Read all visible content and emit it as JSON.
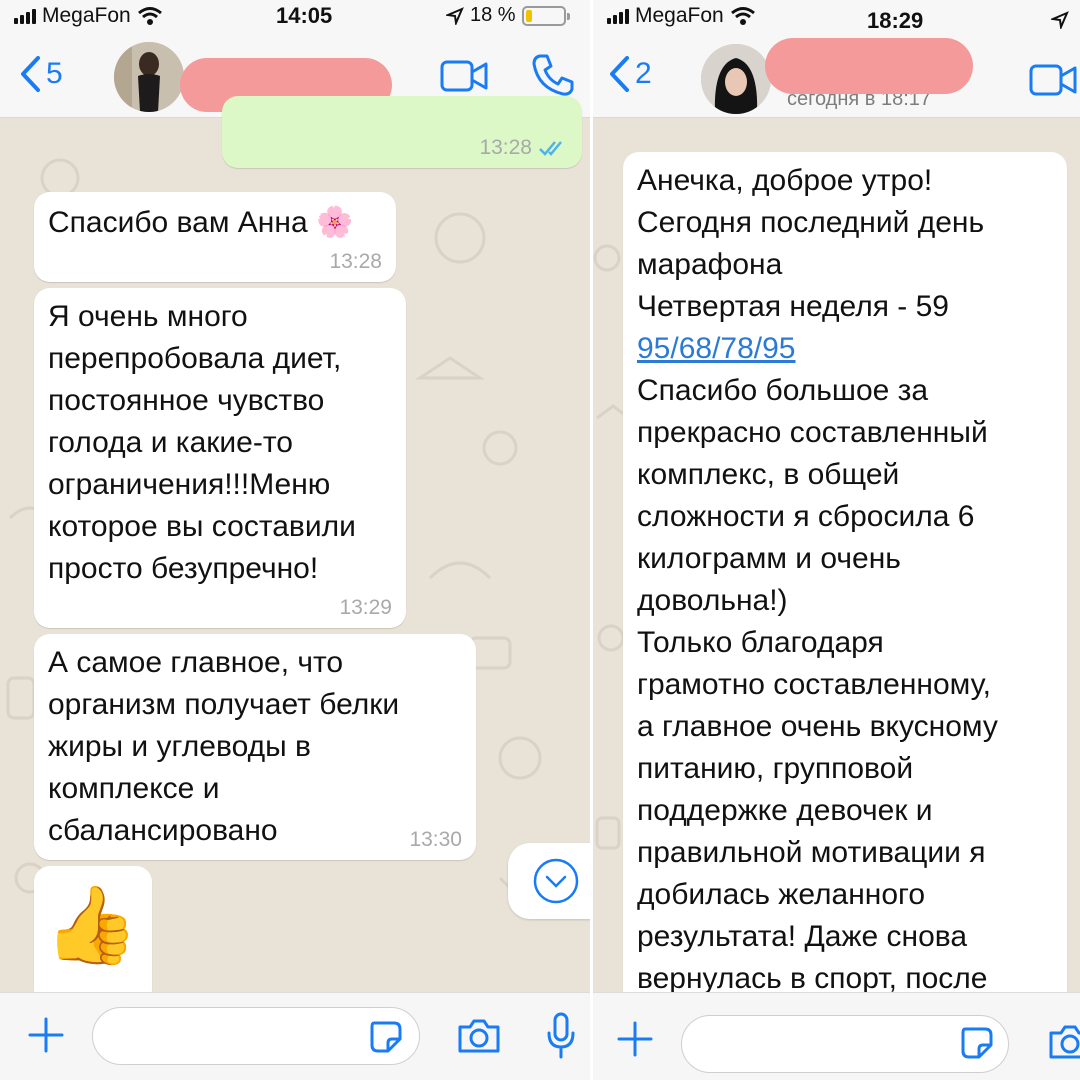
{
  "left": {
    "status": {
      "carrier": "MegaFon",
      "time": "14:05",
      "battery_pct": "18 %",
      "battery_level": 0.18
    },
    "nav": {
      "back_count": "5"
    },
    "messages": [
      {
        "direction": "out",
        "text": "",
        "time": "13:28",
        "read": true
      },
      {
        "direction": "in",
        "text": "Спасибо вам Анна 🌸",
        "time": "13:28"
      },
      {
        "direction": "in",
        "text": "Я очень много\nперепробовала диет,\nпостоянное чувство\nголода и какие-то\nограничения!!!Меню\nкоторое вы составили\nпросто безупречно!",
        "time": "13:29"
      },
      {
        "direction": "in",
        "text": "А самое главное, что\nорганизм получает белки\nжиры и углеводы в\nкомплексе и\nсбалансировано",
        "time": "13:30"
      },
      {
        "direction": "in",
        "text": "👍",
        "time": ""
      }
    ]
  },
  "right": {
    "status": {
      "carrier": "MegaFon",
      "time": "18:29"
    },
    "nav": {
      "back_count": "2",
      "subtitle": "сегодня в 18:17"
    },
    "messages": [
      {
        "direction": "in",
        "text_before": "Анечка, доброе утро!\nСегодня последний день\nмарафона\nЧетвертая неделя - 59",
        "link": "95/68/78/95",
        "text_after": "Спасибо большое за\nпрекрасно составленный\nкомплекс, в общей\nсложности я сбросила 6\nкилограмм и очень\nдовольна!)\nТолько благодаря\nграмотно составленному,\nа главное очень вкусному\nпитанию, групповой\nподдержке девочек и\nправильной мотивации я\nдобилась желанного\nрезультата! Даже снова\nвернулась в спорт, после"
      }
    ]
  },
  "colors": {
    "accent": "#1a7cf5",
    "chat_background": "#e8e2d7",
    "bubble_in": "#ffffff",
    "bubble_out": "#dcf8c6",
    "redaction": "#f59a9a",
    "link": "#2b7bd6"
  },
  "icons": [
    "back-chevron-icon",
    "video-call-icon",
    "phone-call-icon",
    "scroll-down-icon",
    "plus-icon",
    "sticker-icon",
    "camera-icon",
    "microphone-icon",
    "double-check-icon",
    "location-arrow-icon",
    "wifi-icon",
    "signal-icon",
    "battery-icon"
  ]
}
